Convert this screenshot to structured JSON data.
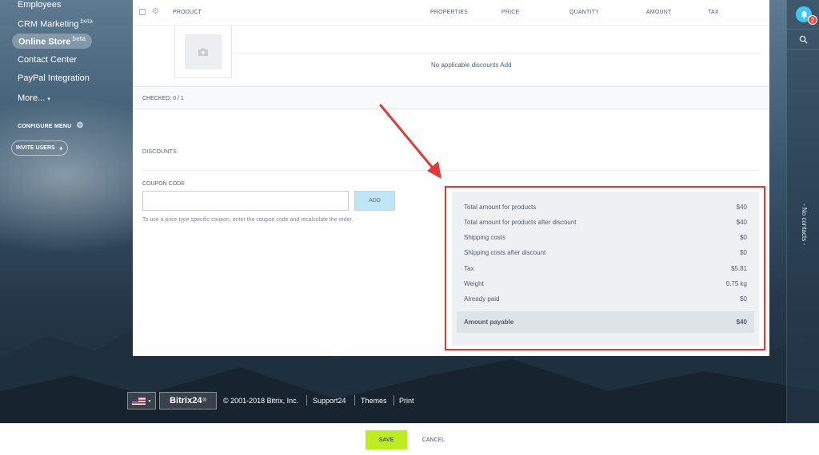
{
  "sidebar": {
    "items": [
      {
        "label": "Employees",
        "badge": ""
      },
      {
        "label": "CRM Marketing",
        "badge": "beta"
      },
      {
        "label": "Online Store",
        "badge": "beta"
      },
      {
        "label": "Contact Center",
        "badge": ""
      },
      {
        "label": "PayPal Integration",
        "badge": ""
      },
      {
        "label": "More...",
        "badge": ""
      }
    ],
    "configure_menu": "CONFIGURE MENU",
    "invite_users": "INVITE USERS"
  },
  "rightbar": {
    "notification_count": "2",
    "no_contacts": "- No contacts -"
  },
  "table": {
    "headers": [
      "PRODUCT",
      "PROPERTIES",
      "PRICE",
      "QUANTITY",
      "AMOUNT",
      "TAX"
    ],
    "no_discounts": "No applicable discounts",
    "add_link": "Add",
    "checked": "CHECKED: 0 / 1"
  },
  "discounts": {
    "title": "DISCOUNTS",
    "coupon_label": "COUPON CODE",
    "coupon_value": "",
    "add_button": "ADD",
    "hint": "To use a price type specific coupon, enter the coupon code and recalculate the order."
  },
  "totals": {
    "rows": [
      {
        "label": "Total amount for products",
        "value": "$40"
      },
      {
        "label": "Total amount for products after discount",
        "value": "$40"
      },
      {
        "label": "Shipping costs",
        "value": "$0"
      },
      {
        "label": "Shipping costs after discount",
        "value": "$0"
      },
      {
        "label": "Tax",
        "value": "$5.81"
      },
      {
        "label": "Weight",
        "value": "0.75 kg"
      },
      {
        "label": "Already paid",
        "value": "$0"
      }
    ],
    "payable_label": "Amount payable",
    "payable_value": "$40"
  },
  "footer": {
    "brand": "Bitrix24",
    "brand_mark": "®",
    "copyright": "© 2001-2018 Bitrix, Inc.",
    "links": [
      "Support24",
      "Themes",
      "Print"
    ]
  },
  "actions": {
    "save": "SAVE",
    "cancel": "CANCEL"
  },
  "colors": {
    "accent": "#3bc8f5",
    "save": "#bbed21",
    "highlight": "#e03a3a",
    "link": "#2067b0"
  }
}
